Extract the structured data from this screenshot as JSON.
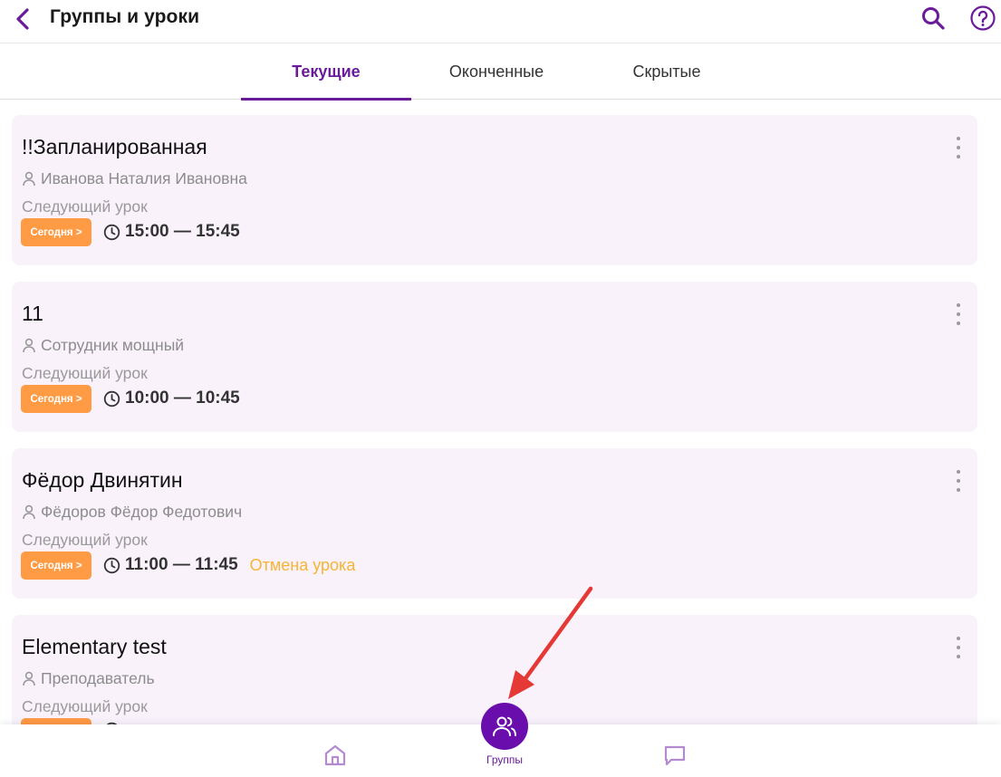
{
  "header": {
    "title": "Группы и уроки",
    "icons": {
      "back": "back-arrow-icon",
      "search": "search-icon",
      "help": "help-icon"
    }
  },
  "tabs": [
    {
      "label": "Текущие",
      "active": true
    },
    {
      "label": "Оконченные",
      "active": false
    },
    {
      "label": "Скрытые",
      "active": false
    }
  ],
  "next_lesson_label": "Следующий урок",
  "today_label": "Сегодня >",
  "groups": [
    {
      "name": "!!Запланированная",
      "teacher": "Иванова Наталия Ивановна",
      "time": "15:00 — 15:45",
      "status": ""
    },
    {
      "name": "11",
      "teacher": "Сотрудник мощный",
      "time": "10:00 — 10:45",
      "status": ""
    },
    {
      "name": "Фёдор Двинятин",
      "teacher": "Фёдоров Фёдор Федотович",
      "time": "11:00 — 11:45",
      "status": "Отмена урока"
    },
    {
      "name": "Elementary test",
      "teacher": "Преподаватель",
      "time": "",
      "status": ""
    }
  ],
  "bottom_nav": {
    "groups_label": "Группы",
    "icons": {
      "home": "home-icon",
      "groups": "users-icon",
      "chat": "chat-icon"
    }
  },
  "colors": {
    "accent": "#6a1b9a",
    "accent_dark": "#6a0dad",
    "card_bg": "#f9f2fb",
    "today_badge": "#ff9a45",
    "cancel_text": "#f7b434",
    "annotation_arrow": "#e53935"
  }
}
